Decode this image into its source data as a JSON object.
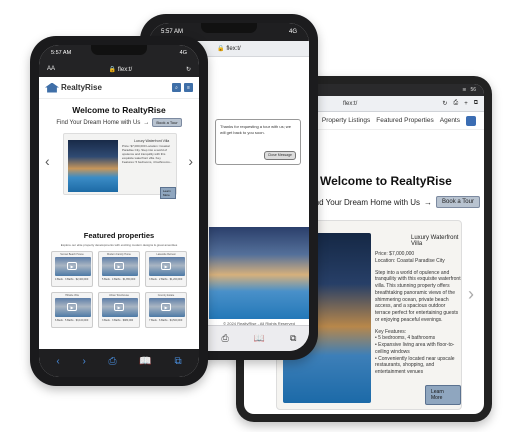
{
  "tablet": {
    "status": {
      "battery": "56"
    },
    "urlbar": {
      "url": "flex:t/",
      "aa": "AA"
    },
    "nav": {
      "items": [
        "Property Listings",
        "Featured Properties",
        "Agents"
      ]
    },
    "hero": {
      "title": "Welcome to RealtyRise",
      "subtitle": "Find Your Dream Home with Us",
      "arrow": "→",
      "tour_button": "Book a Tour"
    },
    "card": {
      "title": "Luxury Waterfront Villa",
      "price": "Price: $7,000,000",
      "location": "Location: Coastal Paradise City",
      "description": "Step into a world of opulence and tranquility with this exquisite waterfront villa. This stunning property offers breathtaking panoramic views of the shimmering ocean, private beach access, and a spacious outdoor terrace perfect for entertaining guests or enjoying peaceful evenings.",
      "features_label": "Key Features:",
      "features": [
        "5 bedrooms, 4 bathrooms",
        "Expansive living area with floor-to-ceiling windows",
        "Conveniently located near upscale restaurants, shopping, and entertainment venues"
      ],
      "learn_more": "Learn More"
    },
    "next_arrow": "›"
  },
  "phone_back": {
    "status": {
      "time": "5:57 AM",
      "signal": "4G"
    },
    "url": "🔒 flex:t/",
    "modal": {
      "text": "Thanks for requesting a tour with us; we will get back to you soon.",
      "button": "Close Message"
    },
    "copyright": "© 2024 RealtyRise - All Rights Reserved",
    "tabbar": {
      "share": "⎙",
      "bookmarks": "📖",
      "tabs": "⧉"
    }
  },
  "phone_front": {
    "status": {
      "time": "5:57 AM",
      "signal": "4G"
    },
    "urlbar": {
      "aa": "AA",
      "url": "🔒 flex:t/",
      "reload": "↻"
    },
    "header": {
      "brand": "RealtyRise"
    },
    "hero": {
      "title": "Welcome to RealtyRise",
      "subtitle": "Find Your Dream Home with Us",
      "arrow": "→",
      "tour_button": "Book a Tour"
    },
    "card": {
      "title": "Luxury Waterfront Villa",
      "text": "Price: $7,000,000 Location: Coastal Paradise City. Step into a world of opulence and tranquility with this exquisite waterfront villa. Key Features: 5 bedrooms, 4 bathrooms...",
      "learn_more": "Learn More"
    },
    "carousel": {
      "prev": "‹",
      "next": "›"
    },
    "featured": {
      "title": "Featured properties",
      "subtitle": "Explore our elite property developments with exciting modern designs & great amenities",
      "properties": [
        {
          "title": "Sunset Beach House",
          "text": "4 Beds · 3 Baths · $2,400,000"
        },
        {
          "title": "Modern Family Home",
          "text": "5 Beds · 4 Baths · $1,850,000"
        },
        {
          "title": "Lakeside Retreat",
          "text": "3 Beds · 2 Baths · $1,200,000"
        },
        {
          "title": "Hillside Villa",
          "text": "6 Beds · 5 Baths · $3,100,000"
        },
        {
          "title": "Urban Townhouse",
          "text": "3 Beds · 3 Baths · $980,000"
        },
        {
          "title": "Country Estate",
          "text": "7 Beds · 6 Baths · $4,500,000"
        }
      ]
    },
    "tabbar": {
      "back": "‹",
      "forward": "›",
      "share": "⎙",
      "bookmarks": "📖",
      "tabs": "⧉"
    }
  }
}
